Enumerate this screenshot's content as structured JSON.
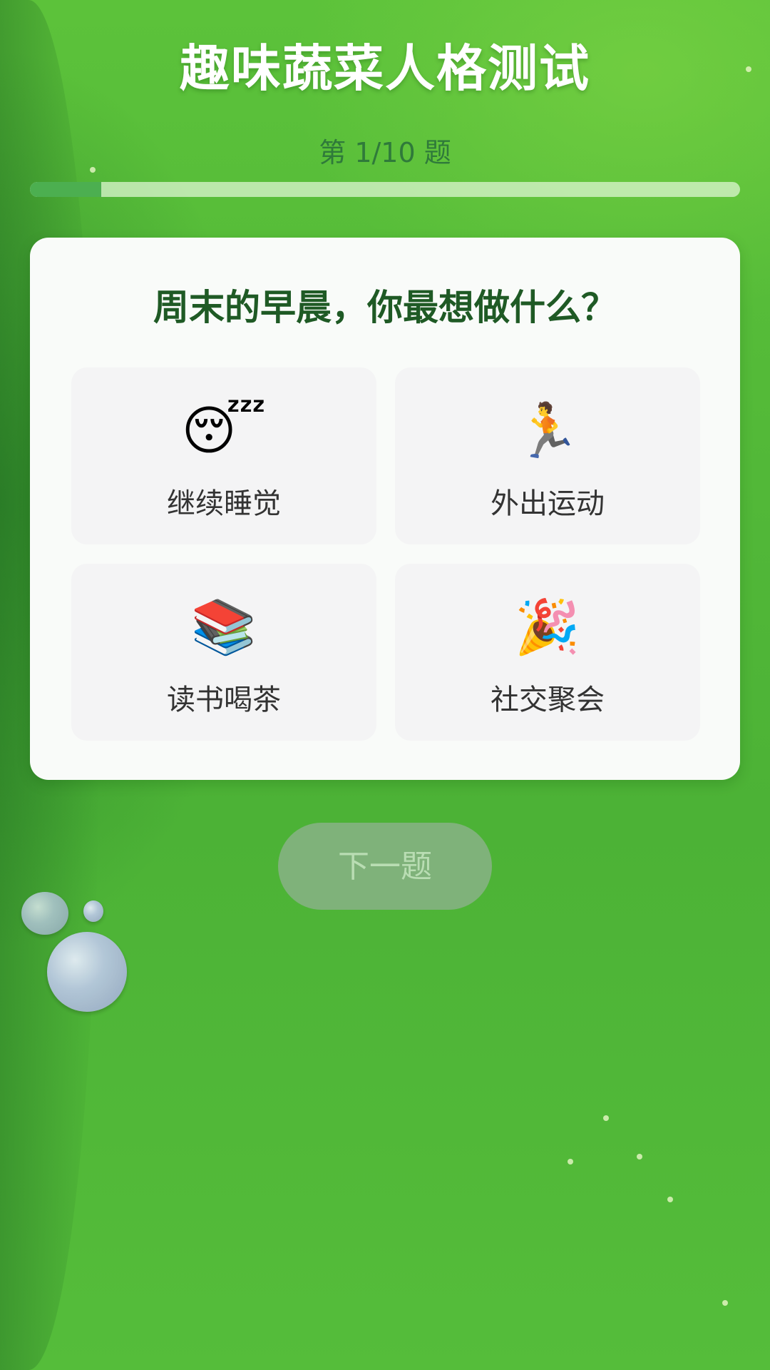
{
  "app": {
    "title": "趣味蔬菜人格测试"
  },
  "progress": {
    "text": "第 1/10 题",
    "current": 1,
    "total": 10
  },
  "question": {
    "text": "周末的早晨，你最想做什么？"
  },
  "options": [
    {
      "emoji": "😴",
      "icon": "sleeping-face-icon",
      "label": "继续睡觉"
    },
    {
      "emoji": "🏃",
      "icon": "running-person-icon",
      "label": "外出运动"
    },
    {
      "emoji": "📚",
      "icon": "books-icon",
      "label": "读书喝茶"
    },
    {
      "emoji": "🎉",
      "icon": "party-popper-icon",
      "label": "社交聚会"
    }
  ],
  "next_button": {
    "label": "下一题",
    "enabled": false
  },
  "colors": {
    "background": "#52b838",
    "title": "#ffffff",
    "progress_text": "#2f7a3a",
    "progress_fill": "#4caf50",
    "question_text": "#1f5a25",
    "next_button_bg": "#7fb27a",
    "next_button_text": "#b9ddb3"
  }
}
